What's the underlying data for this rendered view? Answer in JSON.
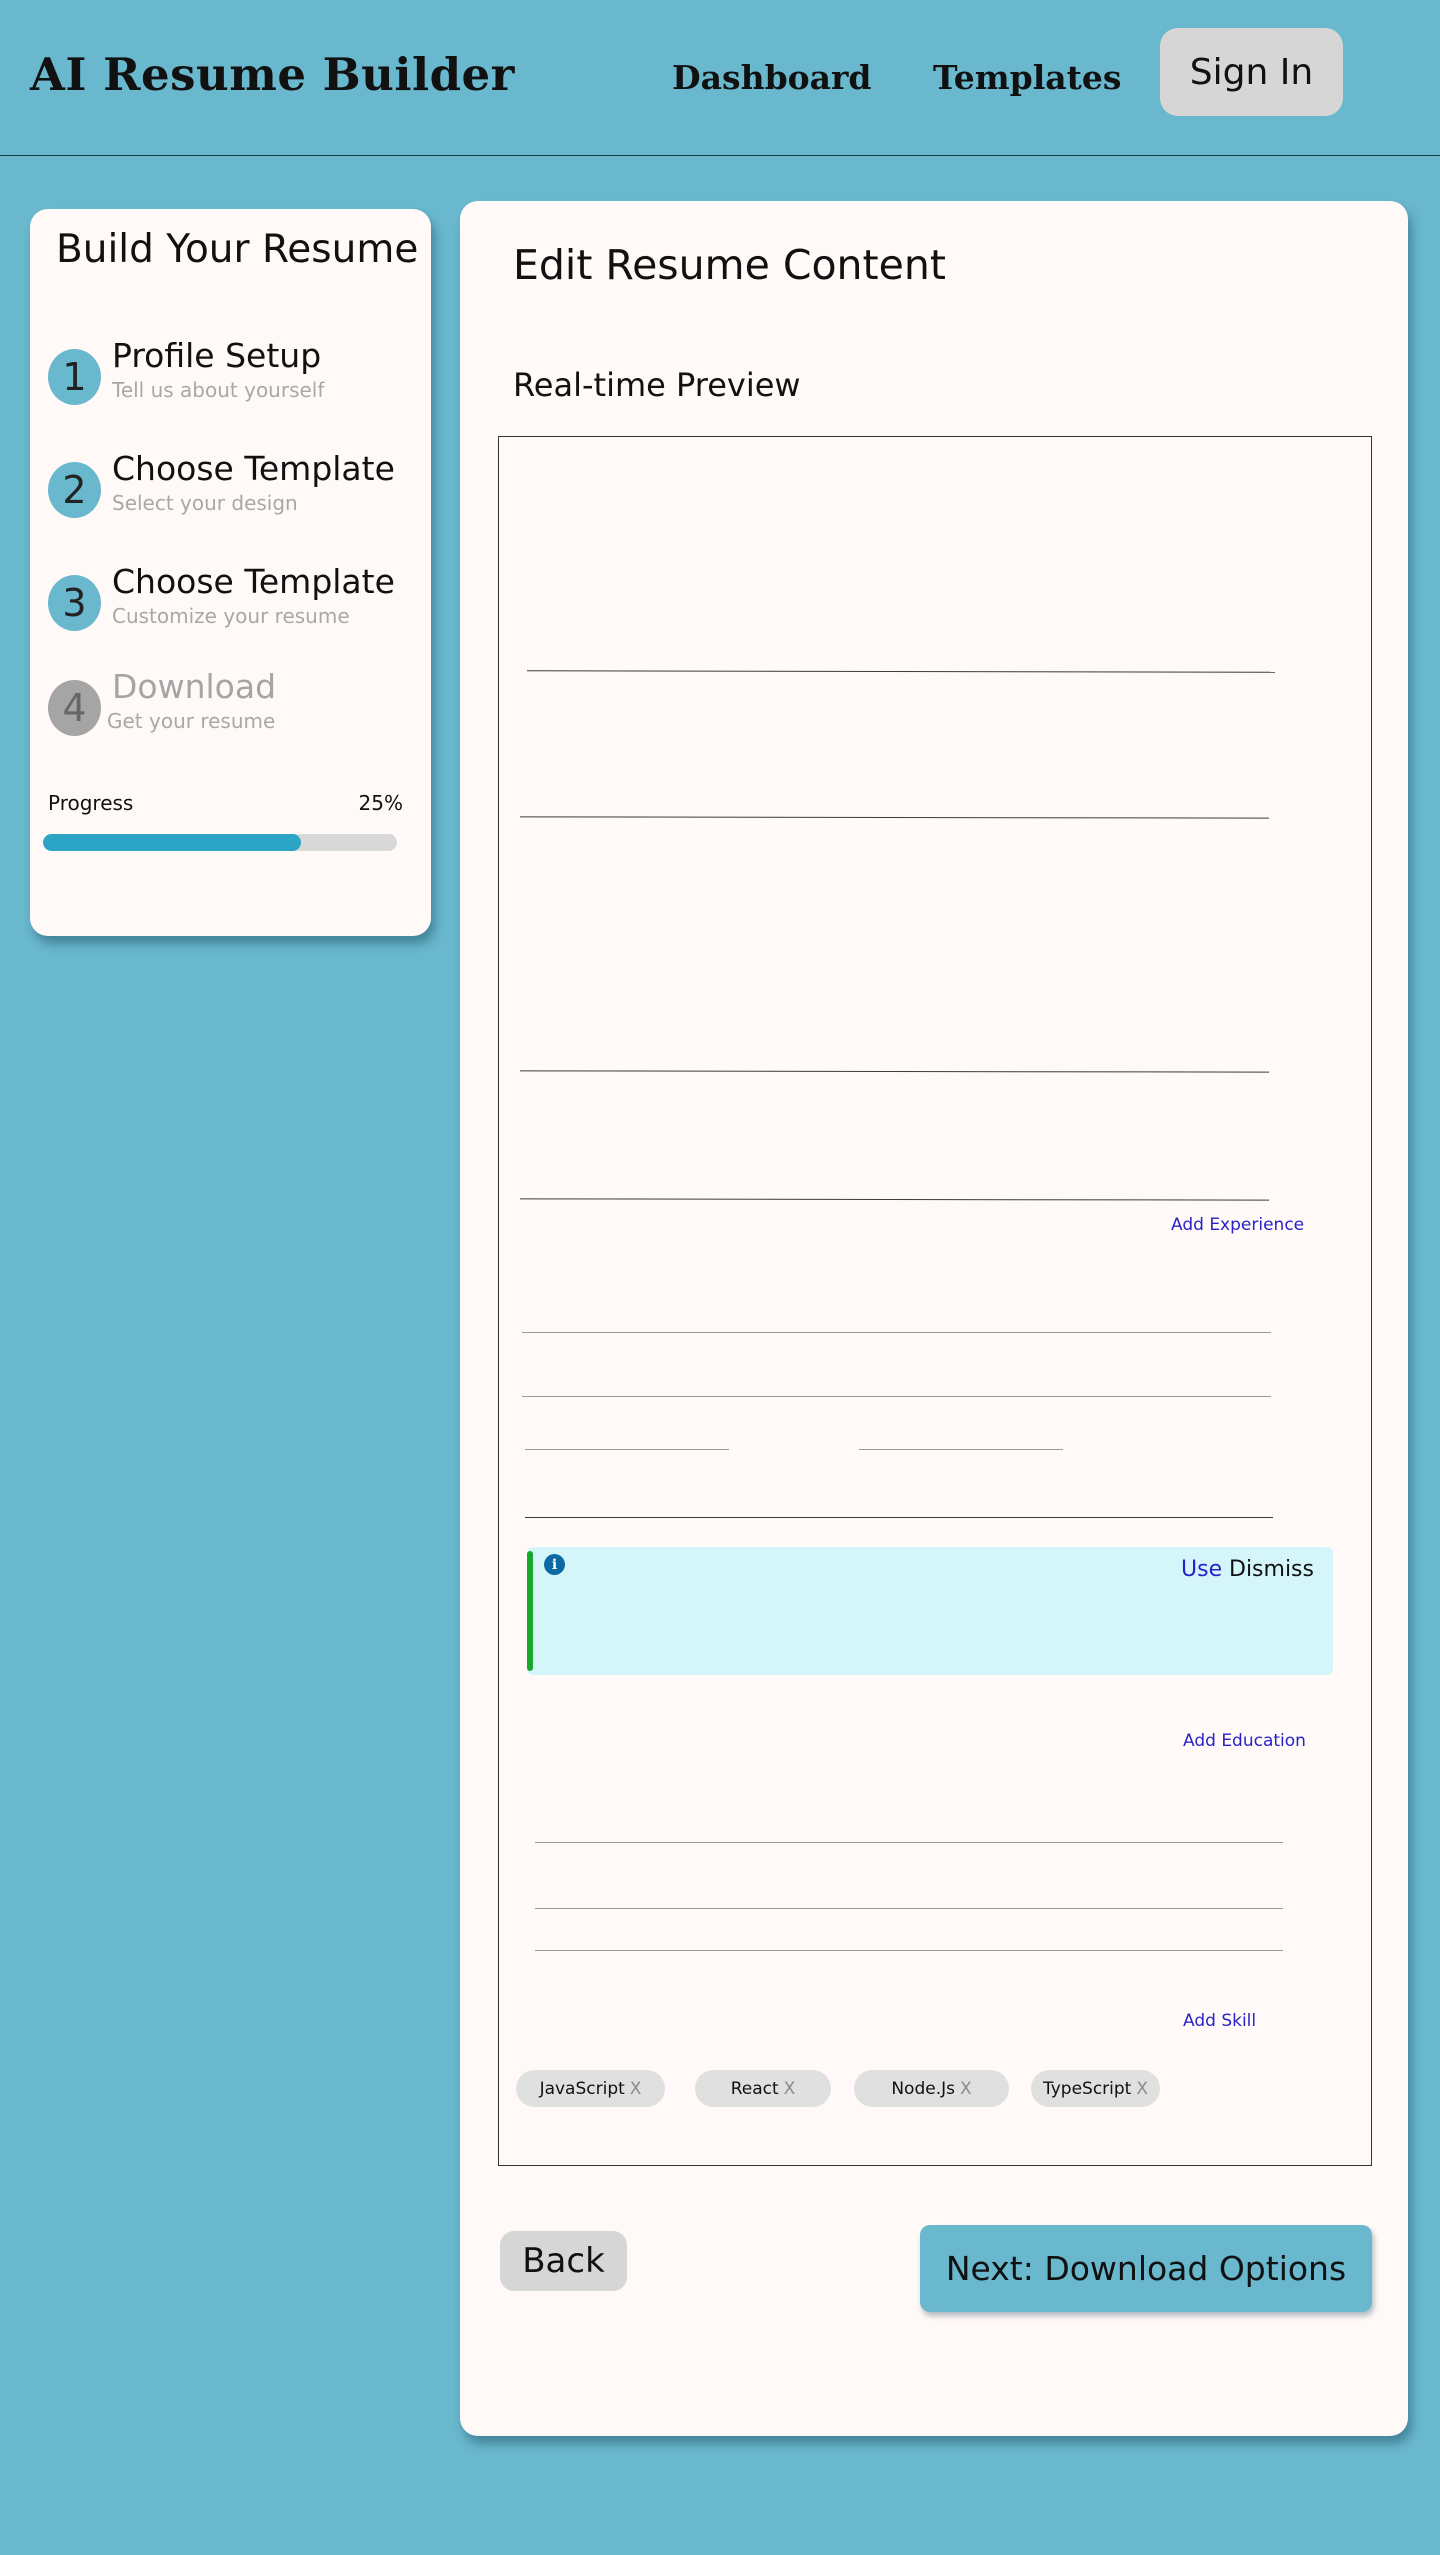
{
  "header": {
    "logo": "AI Resume Builder",
    "nav": [
      {
        "label": "Dashboard"
      },
      {
        "label": "Templates"
      }
    ],
    "signin_label": "Sign In"
  },
  "sidebar": {
    "title": "Build Your Resume",
    "steps": [
      {
        "number": "1",
        "title": "Profile Setup",
        "subtitle": "Tell us about yourself"
      },
      {
        "number": "2",
        "title": "Choose Template",
        "subtitle": "Select your design"
      },
      {
        "number": "3",
        "title": "Choose Template",
        "subtitle": "Customize your resume"
      },
      {
        "number": "4",
        "title": "Download",
        "subtitle": "Get your resume"
      }
    ],
    "progress_label": "Progress",
    "progress_pct": "25%",
    "progress_value": 0.25
  },
  "main": {
    "title": "Edit Resume Content",
    "preview_label": "Real-time Preview",
    "add_experience": "Add Experience",
    "add_education": "Add Education",
    "add_skill": "Add Skill",
    "suggestion": {
      "icon": "info-icon",
      "use_label": "Use",
      "dismiss_label": "Dismiss"
    },
    "skills": [
      {
        "label": "JavaScript",
        "remove": "X"
      },
      {
        "label": "React",
        "remove": "X"
      },
      {
        "label": "Node.Js",
        "remove": "X"
      },
      {
        "label": "TypeScript",
        "remove": "X"
      }
    ],
    "back_label": "Back",
    "next_label": "Next: Download Options"
  },
  "colors": {
    "background": "#69b8ce",
    "card": "#fffaf8",
    "progress_fill": "#2ba4c6",
    "link": "#2a22c8",
    "suggestion_bg": "#d4f6fb",
    "suggestion_bar": "#15a82a"
  }
}
